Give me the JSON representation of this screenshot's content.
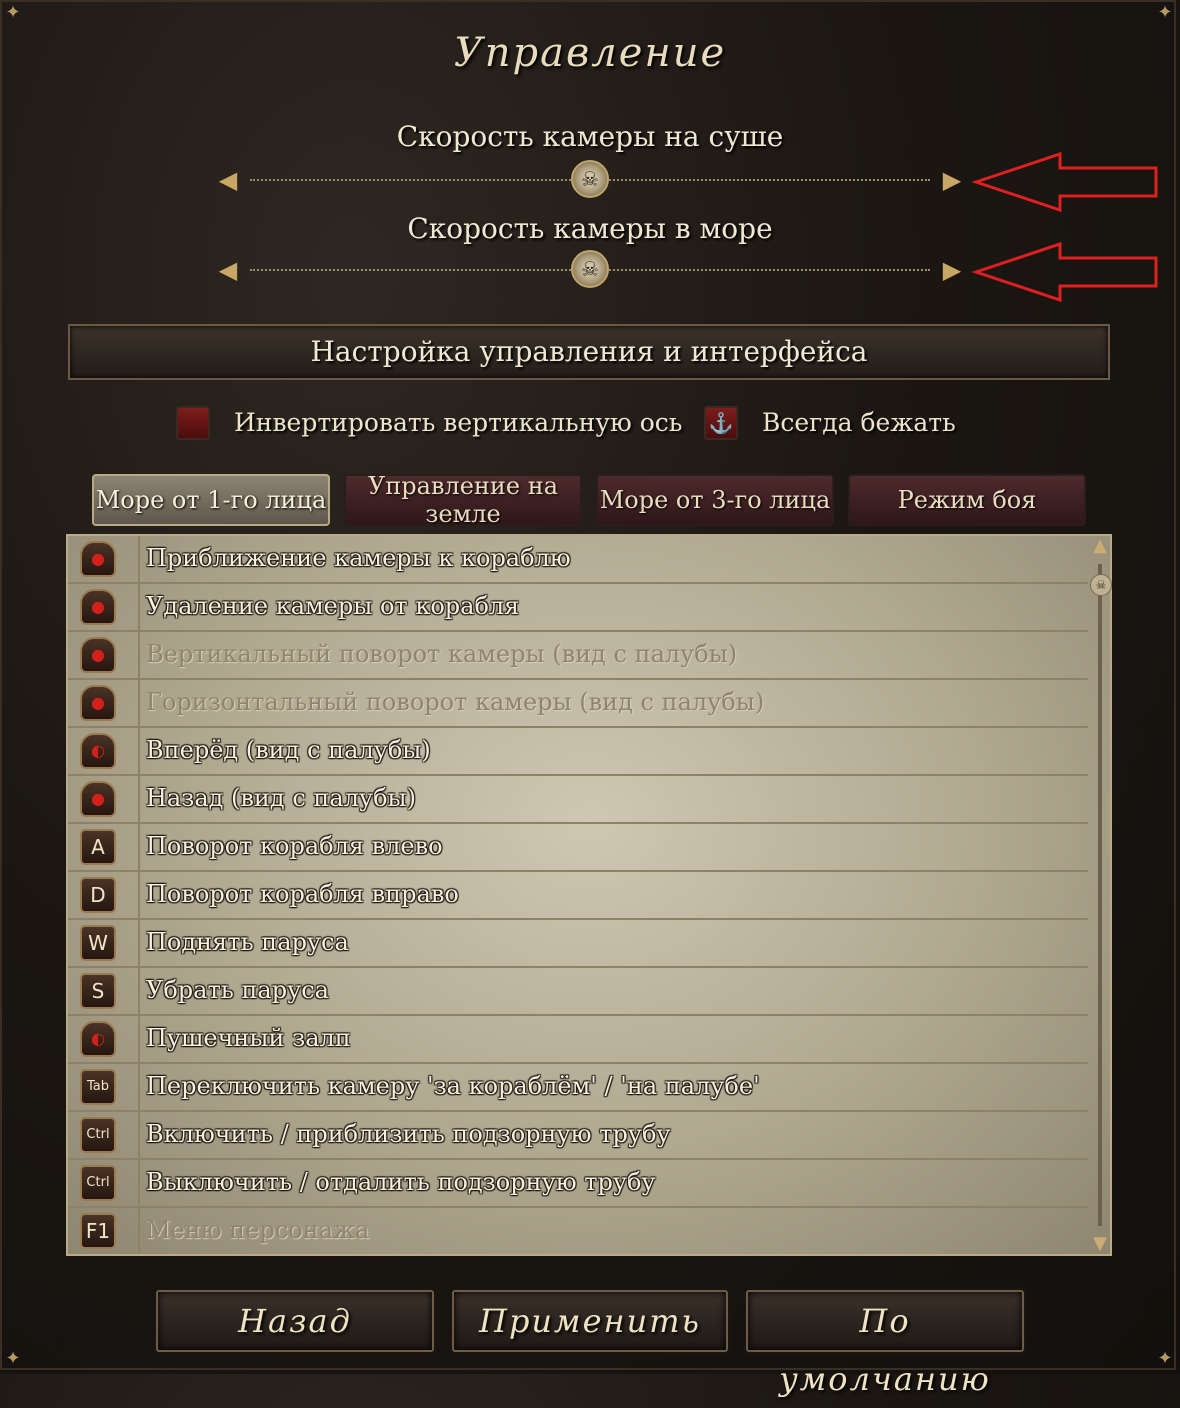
{
  "title": "Управление",
  "sliders": [
    {
      "label": "Скорость камеры на суше",
      "value": 0.5
    },
    {
      "label": "Скорость камеры в море",
      "value": 0.5
    }
  ],
  "section_title": "Настройка управления и интерфейса",
  "options": {
    "invert_axis": {
      "label": "Инвертировать вертикальную ось",
      "checked": false
    },
    "always_run": {
      "label": "Всегда бежать",
      "checked": true
    }
  },
  "tabs": [
    {
      "label": "Море от 1-го лица",
      "active": true
    },
    {
      "label": "Управление на земле",
      "active": false
    },
    {
      "label": "Море от 3-го лица",
      "active": false
    },
    {
      "label": "Режим боя",
      "active": false
    }
  ],
  "bindings": [
    {
      "key": "mouse-wheel-icon",
      "action": "Приближение камеры к кораблю",
      "enabled": true
    },
    {
      "key": "mouse-wheel-icon",
      "action": "Удаление камеры от корабля",
      "enabled": true
    },
    {
      "key": "mouse-wheel-icon",
      "action": "Вертикальный поворот камеры (вид с палубы)",
      "enabled": false
    },
    {
      "key": "mouse-wheel-icon",
      "action": "Горизонтальный поворот камеры (вид с палубы)",
      "enabled": false
    },
    {
      "key": "mouse-left-icon",
      "action": "Вперёд (вид с палубы)",
      "enabled": true
    },
    {
      "key": "mouse-wheel-icon",
      "action": "Назад (вид с палубы)",
      "enabled": true
    },
    {
      "key": "A",
      "action": "Поворот корабля влево",
      "enabled": true
    },
    {
      "key": "D",
      "action": "Поворот корабля вправо",
      "enabled": true
    },
    {
      "key": "W",
      "action": "Поднять паруса",
      "enabled": true
    },
    {
      "key": "S",
      "action": "Убрать паруса",
      "enabled": true
    },
    {
      "key": "mouse-left-icon",
      "action": "Пушечный залп",
      "enabled": true
    },
    {
      "key": "Tab",
      "action": "Переключить камеру 'за кораблём' / 'на палубе'",
      "enabled": true
    },
    {
      "key": "Ctrl",
      "action": "Включить / приблизить подзорную трубу",
      "enabled": true
    },
    {
      "key": "Ctrl",
      "action": "Выключить / отдалить подзорную трубу",
      "enabled": true
    },
    {
      "key": "F1",
      "action": "Меню персонажа",
      "enabled": false
    }
  ],
  "buttons": {
    "back": "Назад",
    "apply": "Применить",
    "default": "По умолчанию"
  },
  "colors": {
    "annotation_arrow": "#e02020",
    "active_tab": "#8c8473",
    "inactive_tab": "#4e2a2c"
  }
}
